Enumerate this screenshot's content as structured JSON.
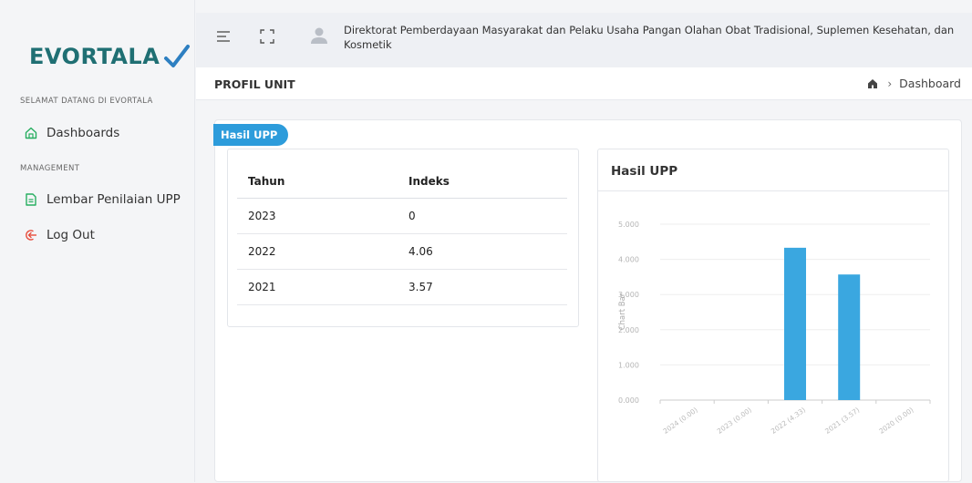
{
  "sidebar": {
    "logo_text": "EVORTALA",
    "welcome": "SELAMAT DATANG DI EVORTALA",
    "dashboards_label": "Dashboards",
    "management_label": "MANAGEMENT",
    "lembar_label": "Lembar Penilaian UPP",
    "logout_label": "Log Out"
  },
  "topbar": {
    "org_name": "Direktorat Pemberdayaan Masyarakat dan Pelaku Usaha Pangan Olahan Obat Tradisional, Suplemen Kesehatan, dan Kosmetik"
  },
  "header": {
    "title": "PROFIL UNIT",
    "breadcrumb": "Dashboard"
  },
  "main": {
    "badge": "Hasil UPP",
    "table": {
      "headers": [
        "Tahun",
        "Indeks"
      ],
      "rows": [
        [
          "2023",
          "0"
        ],
        [
          "2022",
          "4.06"
        ],
        [
          "2021",
          "3.57"
        ]
      ]
    },
    "chart_title": "Hasil UPP"
  },
  "colors": {
    "accent": "#2d9cdb",
    "bar": "#3aa7e0",
    "logo": "#1f6f73"
  },
  "chart_data": {
    "type": "bar",
    "title": "Hasil UPP",
    "ylabel": "Chart Bar",
    "xlabel": "",
    "categories": [
      "2024 (0.00)",
      "2023 (0.00)",
      "2022 (4.33)",
      "2021 (3.57)",
      "2020 (0.00)"
    ],
    "values": [
      0,
      0,
      4.33,
      3.57,
      0
    ],
    "yticks": [
      "0.000",
      "1.000",
      "2.000",
      "3.000",
      "4.000",
      "5.000"
    ],
    "ylim": [
      0,
      5
    ],
    "grid": true
  }
}
